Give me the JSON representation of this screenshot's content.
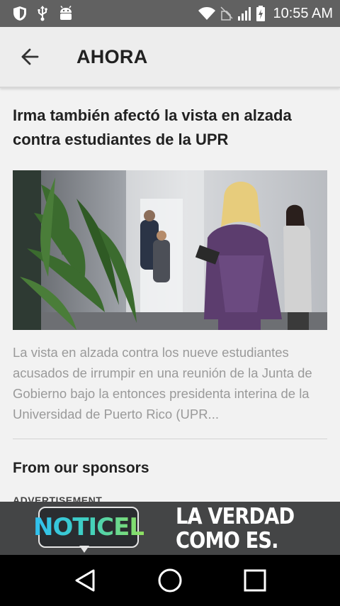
{
  "status_bar": {
    "time": "10:55 AM",
    "left_icons": [
      "shield-icon",
      "usb-icon",
      "android-icon"
    ],
    "right_icons": [
      "wifi-icon",
      "no-sim-icon",
      "signal-icon",
      "battery-charging-icon"
    ]
  },
  "app_bar": {
    "title": "AHORA",
    "back_icon": "arrow-left-icon"
  },
  "article": {
    "headline": "Irma también afectó la vista en alzada contra estudiantes de la UPR",
    "summary": "La vista en alzada contra los nueve estudiantes acusados de irrumpir en una reunión de la Junta de Gobierno bajo la entonces presidenta interina de la Universidad de Puerto Rico (UPR..."
  },
  "sponsors": {
    "title": "From our sponsors",
    "ad_label": "ADVERTISEMENT"
  },
  "ad_banner": {
    "logo_text": "NOTICEL",
    "tagline_line1": "LA VERDAD",
    "tagline_line2": "COMO ES.",
    "colors": {
      "background": "#444546",
      "logo_gradient_start": "#30c0f0",
      "logo_gradient_end": "#8fe060"
    }
  },
  "nav_bar": {
    "buttons": [
      "back-triangle-icon",
      "home-circle-icon",
      "recents-square-icon"
    ]
  },
  "colors": {
    "status_bar": "#616161",
    "app_bar": "#ededed",
    "page_background": "#f2f2f2",
    "headline": "#212121",
    "summary": "#9a9a9a"
  }
}
